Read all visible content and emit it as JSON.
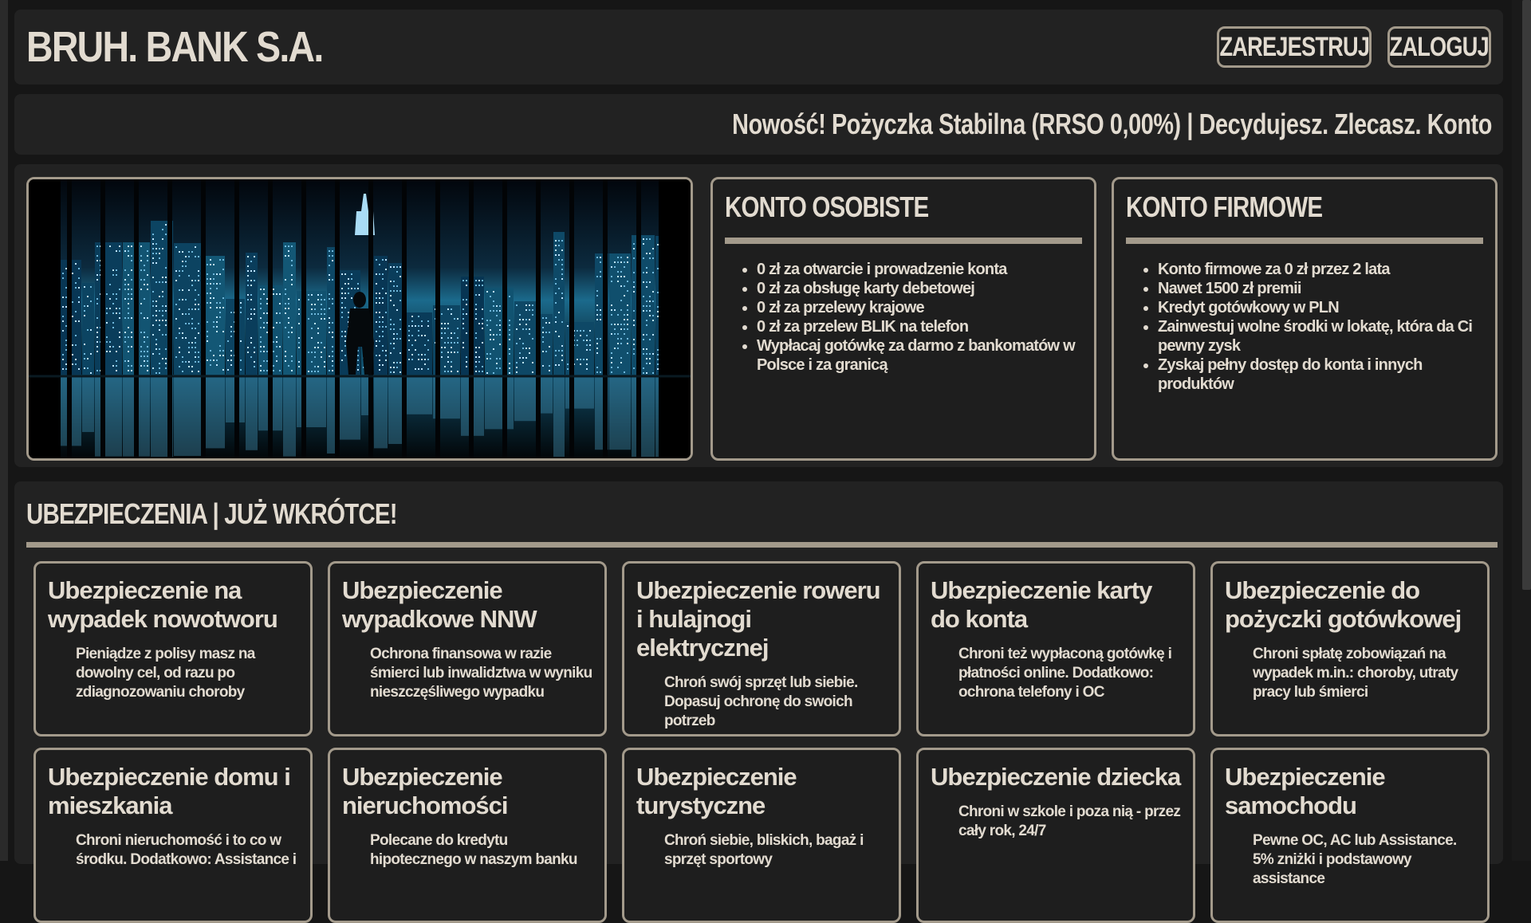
{
  "header": {
    "logo": "BRUH. BANK S.A.",
    "register_label": "ZAREJESTRUJ",
    "login_label": "ZALOGUJ"
  },
  "ticker": {
    "text": "Nowość! Pożyczka Stabilna (RRSO 0,00%) | Decydujesz. Zlecasz. Konto"
  },
  "hero": {
    "image": "city-skyline-night-silhouette"
  },
  "cards": {
    "personal": {
      "title": "KONTO OSOBISTE",
      "items": [
        "0 zł za otwarcie i prowadzenie konta",
        "0 zł za obsługę karty debetowej",
        "0 zł za przelewy krajowe",
        "0 zł za przelew BLIK na telefon",
        "Wypłacaj gotówkę za darmo z bankomatów w Polsce i za granicą"
      ]
    },
    "business": {
      "title": "KONTO FIRMOWE",
      "items": [
        "Konto firmowe za 0 zł przez 2 lata",
        "Nawet 1500 zł premii",
        "Kredyt gotówkowy w PLN",
        "Zainwestuj wolne środki w lokatę, która da Ci pewny zysk",
        "Zyskaj pełny dostęp do konta i innych produktów"
      ]
    }
  },
  "insurance": {
    "title": "UBEZPIECZENIA | JUŻ WKRÓTCE!",
    "items": [
      {
        "name": "Ubezpieczenie na wypadek nowotworu",
        "desc": "Pieniądze z polisy masz na dowolny cel, od razu po zdiagnozowaniu choroby"
      },
      {
        "name": "Ubezpieczenie wypadkowe NNW",
        "desc": "Ochrona finansowa w razie śmierci lub inwalidztwa w wyniku nieszczęśliwego wypadku"
      },
      {
        "name": "Ubezpieczenie roweru i hulajnogi elektrycznej",
        "desc": "Chroń swój sprzęt lub siebie. Dopasuj ochronę do swoich potrzeb"
      },
      {
        "name": "Ubezpieczenie karty do konta",
        "desc": "Chroni też wypłaconą gotówkę i płatności online. Dodatkowo: ochrona telefony i OC"
      },
      {
        "name": "Ubezpieczenie do pożyczki gotówkowej",
        "desc": "Chroni spłatę zobowiązań na wypadek m.in.: choroby, utraty pracy lub śmierci"
      },
      {
        "name": "Ubezpieczenie domu i mieszkania",
        "desc": "Chroni nieruchomość i to co w środku. Dodatkowo: Assistance i"
      },
      {
        "name": "Ubezpieczenie nieruchomości",
        "desc": "Polecane do kredytu hipotecznego w naszym banku"
      },
      {
        "name": "Ubezpieczenie turystyczne",
        "desc": "Chroń siebie, bliskich, bagaż i sprzęt sportowy"
      },
      {
        "name": "Ubezpieczenie dziecka",
        "desc": "Chroni w szkole i poza nią - przez cały rok, 24/7"
      },
      {
        "name": "Ubezpieczenie samochodu",
        "desc": "Pewne OC, AC lub Assistance. 5% zniżki i podstawowy assistance"
      }
    ]
  },
  "colors": {
    "background": "#161616",
    "panel": "#222222",
    "text": "#e2dbd0",
    "accent_border": "#a39a8b"
  }
}
